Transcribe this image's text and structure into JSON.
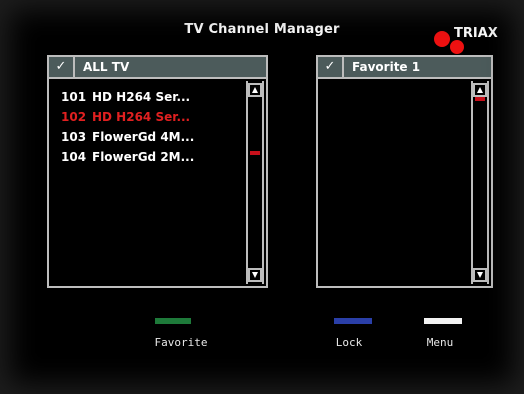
{
  "header": {
    "title": "TV Channel Manager",
    "brand": "TRIAX"
  },
  "left_panel": {
    "checked": "✓",
    "title": "ALL TV",
    "channels": [
      {
        "number": "101",
        "name": "HD H264 Ser..."
      },
      {
        "number": "102",
        "name": "HD H264 Ser..."
      },
      {
        "number": "103",
        "name": "FlowerGd 4M..."
      },
      {
        "number": "104",
        "name": "FlowerGd 2M..."
      }
    ],
    "selected_index": 1
  },
  "right_panel": {
    "checked": "✓",
    "title": "Favorite 1",
    "channels": []
  },
  "legend": {
    "favorite": {
      "label": "Favorite",
      "color": "#1e7a3a"
    },
    "lock": {
      "label": "Lock",
      "color": "#2a3fa8"
    },
    "menu": {
      "label": "Menu",
      "color": "#f2f2f2"
    }
  },
  "colors": {
    "panel_header": "#4c5b5b",
    "selected_text": "#e02020",
    "brand_red": "#e11111"
  }
}
